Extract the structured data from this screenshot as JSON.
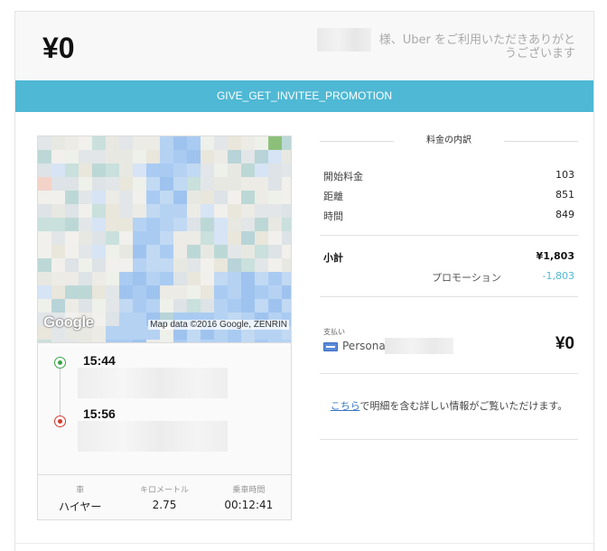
{
  "receipt": {
    "total": "¥0",
    "thanks": "様、Uber をご利用いただきありがとうございます"
  },
  "promotion": {
    "code": "GIVE_GET_INVITEE_PROMOTION"
  },
  "map": {
    "logo": "Google",
    "credit": "Map data ©2016 Google, ZENRIN"
  },
  "route": {
    "start_time": "15:44",
    "end_time": "15:56"
  },
  "stats": [
    {
      "label": "車",
      "value": "ハイヤー"
    },
    {
      "label": "キロメートル",
      "value": "2.75"
    },
    {
      "label": "乗車時間",
      "value": "00:12:41"
    }
  ],
  "fare": {
    "title": "料金の内訳",
    "items": [
      {
        "label": "開始料金",
        "value": "103"
      },
      {
        "label": "距離",
        "value": "851"
      },
      {
        "label": "時間",
        "value": "849"
      }
    ],
    "subtotal_label": "小計",
    "subtotal_value": "¥1,803",
    "promo_label": "プロモーション",
    "promo_value": "-1,803",
    "payment_label": "支払い",
    "payment_name": "Persona",
    "payment_amount": "¥0",
    "details_link": "こちら",
    "details_text": "で明細を含む詳しい情報がご覧いただけます。"
  },
  "colors": {
    "promo_bar": "#4fb8d4",
    "link": "#3a79c4",
    "start_marker": "#3aa346",
    "end_marker": "#d33a2c"
  }
}
